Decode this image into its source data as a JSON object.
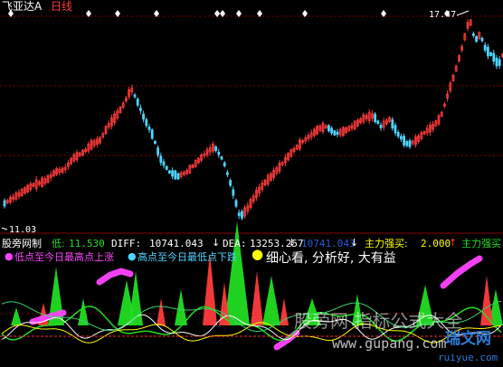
{
  "top_header": {
    "symbol_name": "飞亚达A",
    "period": "日线",
    "high_marker": "17.47",
    "low_marker": "11.03"
  },
  "indicator_header": {
    "name": "股旁网制",
    "low_label": "低:",
    "low_value": "11.530",
    "diff_label": "DIFF:",
    "diff_value": "10741.043",
    "dea_label": "DEA:",
    "dea_value": "13253.257",
    "third_value": "10741.043",
    "strength_label": "主力强买:",
    "strength_value": "2.000",
    "strength_label2": "主力强买"
  },
  "legend": {
    "item1": "低点至今日最高点上涨",
    "item2": "高点至今日最低点下跌",
    "note": "细心看, 分析好, 大有益"
  },
  "watermarks": {
    "main": "股旁网 指标公式大全",
    "url": "www.gupang.com",
    "logo": "瑞文网",
    "logo_url": "ruiyue.com"
  },
  "colors": {
    "up": "#ff3b3b",
    "down": "#4fd4ff",
    "grid_red": "#8b0000",
    "magenta": "#ff44ff",
    "green": "#22dd22",
    "yellow": "#ffff00",
    "white": "#ffffff"
  },
  "icons": [
    "diamond-marker-icon",
    "arrow-down-icon",
    "arrow-up-icon",
    "circle-dot-icon"
  ]
}
